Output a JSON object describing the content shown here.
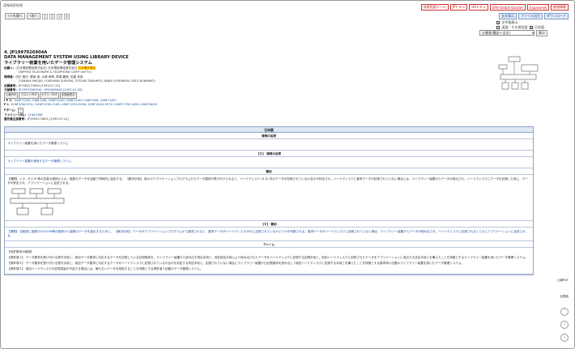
{
  "header": {
    "title": "速報検索結果"
  },
  "nav": {
    "first": "<<先頭へ",
    "prev": "<前へ",
    "pages": [
      "1",
      "2",
      "3",
      "4"
    ]
  },
  "tools": {
    "row1": [
      "技術用語ツール",
      "JPドキュ",
      "USドキュ",
      "EPO Global Dossier",
      "Espacenet",
      "経過情報"
    ],
    "row2": [
      "全文表示",
      "ファイル出力",
      "ダウンロード"
    ]
  },
  "options": {
    "item1": "文中図表示",
    "item2": "英語／その他言語",
    "item3": "日本語",
    "select_value": "分類表(書誌＋全文)",
    "go": "表示"
  },
  "record": {
    "number": "4. JP1997026904A",
    "title_en": "DATA MANAGEMENT SYSTEM USING LIBRARY DEVICE",
    "title_ja": "ライブラリー装置を用いたデータ管理システム",
    "applicant_label": "出願人：",
    "applicant": "(日本電信電話株式会社) 日本電信電話株式会社",
    "applicant_hl": "日本電信電話",
    "applicant_en": "(NIPPON TELEGRAPH & TELEPHONE CORP <NTT>)",
    "inventor_label": "発明者：",
    "inventor": "田中 雅夫, 藤嶋 進, 大塚 孝博, 馬場 義徳, 佐藤 邦彦",
    "inventor_en": "(TANAKA MASAO, FUJISHIMA SUSUMU, OTSUKA TAKAHIRO, BABA YOSHINORI, SATO KUNIHIKO)",
    "appno_label": "出願番号：",
    "appno": "JP1995173605 [1995-07-10]",
    "pubno_label": "文献番号：",
    "pubno": "JP1997026904A , JP9026904A [1997-01-28]",
    "mini_buttons": [
      "公報PDF",
      "フロントPDF",
      "サマリーPDF",
      "全図面表示"
    ],
    "ipc_label": "I P C：",
    "ipc": "G06F12/00; G06F3/06; G06F13/00; G06F12/00; G06F3/06; G06F13/00",
    "fi_label": "F I：",
    "fi": "G06F3/06,301L; G06F12/00,514K; G06F12/00,545A; G06F13/00,357Z; G06F17/30,160D; G06F16/00",
    "fterm_label": "Fターム：",
    "family_label": "ファミリー(ID)：",
    "family": "11587496",
    "priority_label": "優先権主張番号：",
    "priority": "JP1995173605 [1995-07-10]"
  },
  "side": {
    "pdf_label": "公報PDF",
    "all_label": "全図面"
  },
  "doc": {
    "lang_header": "日本語",
    "sections": [
      {
        "heading": "発明の名称",
        "text": "ライブラリー装置を用いたデータ管理システム"
      },
      {
        "heading": "【Ｅ】 発明の名称",
        "text": "ライブラリー装置を使用するデータ管理システム"
      },
      {
        "heading": "要約",
        "text": "【課題】 C D - R O M 等の多数の媒体からの、複数のデータを自動で同時的に抽出する。 【解決手段】 個々のアプリケーションプログラムからデータ要求が受け付けられると、ハードディスク (H D) 内のデータが記録されているか否かが判定され、ハードディスクに要求データが記録されていない場合には、ライブラリー装置からデータが読出され、ハードディスクにデータを記録した後に、データが読出され、アプリケーションに返送される。"
      },
      {
        "heading": "【Ｅ】 要約",
        "text": "【課題】 自動的に複数のCD-ROM等の媒体から複数のデータを抽出するために。 【解決手段】 データがアプリケーションプログラムから要求されると、要求データがハードディスク(HD)に記録されているかどうかが判断される。要求データがハードディスクに記録されていない場合、ライブラリー装置からデータが読み出され、ハードディスクに記録されるとともにアプリケーションに返送される。"
      },
      {
        "heading": "クレーム",
        "subhead": "【特許請求の範囲】",
        "text": "【請求項１】 データ要求を受け付ける受付手段と、前記データ要求に対応するデータを記憶している記憶媒体を、ライブラリー装置から読み出す読出手段と、前記読出手段により読み出されたデータをハードディスクに記録する記録手段と、前記ハードディスクに記録されたデータをアプリケーションに送出する送出手段とを備えたことを特徴とするライブラリー装置を用いたデータ管理システム。",
        "text2": "【請求項２】 データ要求を受け付ける受付手段と、前記データ要求に対応するデータがハードディスクに記録されているか否かを判定する判定手段と、記録されていない場合にライブラリー装置から記憶媒体を読み出して前記ハードディスクに記録する手段とを備えたことを特徴とする請求項１記載のライブラリー装置を用いたデータ管理システム。",
        "text3": "【請求項３】 前記ハードディスクの記憶容量が不足する場合には、最も古いデータを削除することを特徴とする請求項１記載のデータ管理システム。"
      }
    ]
  }
}
